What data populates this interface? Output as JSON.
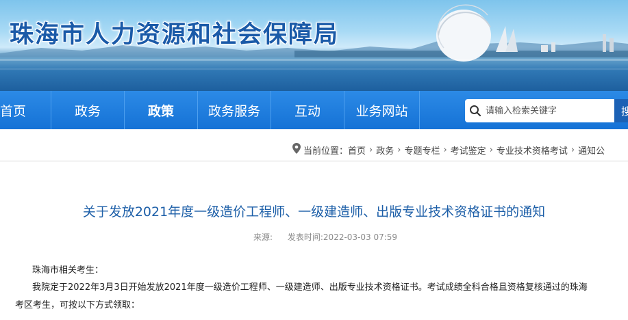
{
  "header": {
    "site_title": "珠海市人力资源和社会保障局"
  },
  "nav": {
    "items": [
      {
        "label": "首页"
      },
      {
        "label": "政务"
      },
      {
        "label": "政策"
      },
      {
        "label": "政务服务"
      },
      {
        "label": "互动"
      },
      {
        "label": "业务网站"
      }
    ],
    "active_index": 2
  },
  "search": {
    "placeholder": "请输入检索关键字",
    "button_label": "搜"
  },
  "breadcrumb": {
    "prefix": "当前位置：",
    "items": [
      "首页",
      "政务",
      "专题专栏",
      "考试鉴定",
      "专业技术资格考试",
      "通知公"
    ]
  },
  "article": {
    "title": "关于发放2021年度一级造价工程师、一级建造师、出版专业技术资格证书的通知",
    "source_label": "来源:",
    "time_label": "发表时间:2022-03-03 07:59",
    "greeting": "珠海市相关考生：",
    "para1": "我院定于2022年3月3日开始发放2021年度一级造价工程师、一级建造师、出版专业技术资格证书。考试成绩全科合格且资格复核通过的珠海",
    "para2": "考区考生，可按以下方式领取："
  },
  "colors": {
    "nav_bg": "#1572d6",
    "title_blue": "#1d5fa8",
    "site_title_blue": "#1a5aa8"
  }
}
